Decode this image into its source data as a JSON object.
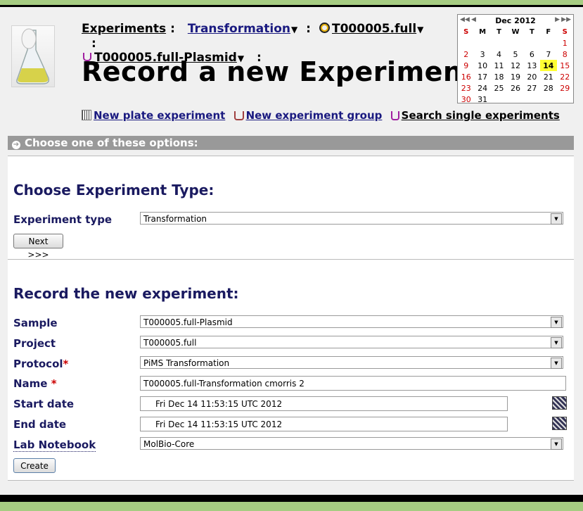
{
  "breadcrumb": {
    "items": [
      {
        "label": "Experiments"
      },
      {
        "label": "Transformation"
      },
      {
        "label": "T000005.full"
      },
      {
        "label": "T000005.full-Plasmid"
      }
    ],
    "separator": ":"
  },
  "page_title": "Record a new Experiment",
  "calendar": {
    "month_label": "Dec 2012",
    "day_headers": [
      "S",
      "M",
      "T",
      "W",
      "T",
      "F",
      "S"
    ],
    "weeks": [
      [
        "",
        "",
        "",
        "",
        "",
        "",
        "1"
      ],
      [
        "2",
        "3",
        "4",
        "5",
        "6",
        "7",
        "8"
      ],
      [
        "9",
        "10",
        "11",
        "12",
        "13",
        "14",
        "15"
      ],
      [
        "16",
        "17",
        "18",
        "19",
        "20",
        "21",
        "22"
      ],
      [
        "23",
        "24",
        "25",
        "26",
        "27",
        "28",
        "29"
      ],
      [
        "30",
        "31",
        "",
        "",
        "",
        "",
        ""
      ]
    ],
    "today": "14",
    "colors": {
      "weekend": "#cc0000",
      "today_bg": "#ffff33"
    }
  },
  "quick_links": {
    "new_plate": "New plate experiment",
    "new_group": "New experiment group",
    "search_single": "Search single experiments"
  },
  "options_header": "Choose one of these options:",
  "choose_type": {
    "heading": "Choose Experiment Type:",
    "type_label": "Experiment type",
    "type_value": "Transformation",
    "next_button": "Next >>>"
  },
  "record": {
    "heading": "Record the new experiment:",
    "sample_label": "Sample",
    "sample_value": "T000005.full-Plasmid",
    "project_label": "Project",
    "project_value": "T000005.full",
    "protocol_label": "Protocol",
    "protocol_value": "PiMS Transformation",
    "name_label": "Name",
    "name_value": "T000005.full-Transformation cmorris 2",
    "start_label": "Start date",
    "start_value": "Fri Dec 14 11:53:15 UTC 2012",
    "end_label": "End date",
    "end_value": "Fri Dec 14 11:53:15 UTC 2012",
    "notebook_label": "Lab Notebook",
    "notebook_value": "MolBio-Core",
    "required_marker": "*",
    "create_button": "Create"
  },
  "colors": {
    "accent_band": "#a6cc82",
    "heading_blue": "#1a1a60",
    "options_bar": "#999999"
  }
}
